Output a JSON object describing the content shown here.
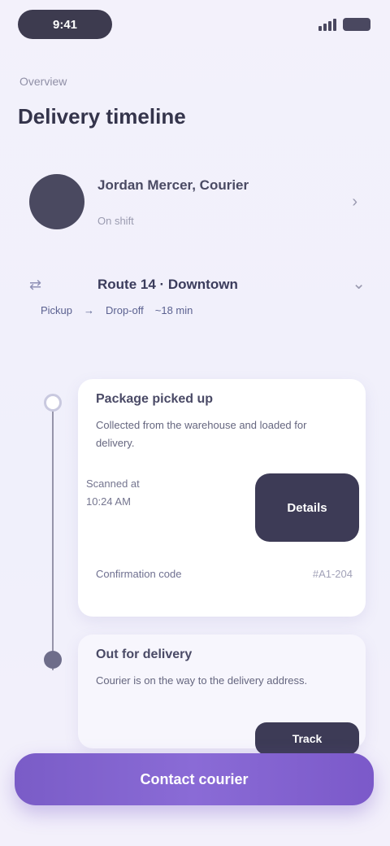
{
  "status_bar": {
    "time": "9:41"
  },
  "breadcrumb": "Overview",
  "page_title": "Delivery timeline",
  "profile": {
    "name": "Jordan Mercer, Courier",
    "subtitle": "On shift"
  },
  "route": {
    "title": "Route 14 · Downtown",
    "from": "Pickup",
    "to": "Drop-off",
    "eta": "~18 min"
  },
  "steps": [
    {
      "title": "Package picked up",
      "description": "Collected from the warehouse and loaded for delivery.",
      "kv_label": "Scanned at",
      "kv_value": "10:24 AM",
      "action_label": "Details",
      "footer_left": "Confirmation code",
      "footer_right": "#A1-204"
    },
    {
      "title": "Out for delivery",
      "description": "Courier is on the way to the delivery address.",
      "action_label": "Track"
    }
  ],
  "cta_label": "Contact courier"
}
